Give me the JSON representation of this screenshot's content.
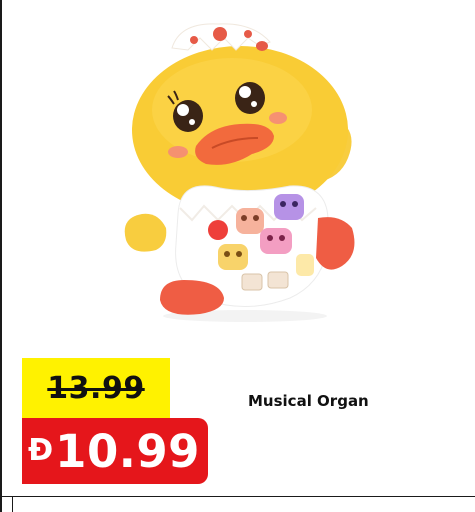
{
  "product": {
    "name": "Musical Organ",
    "image_alt_icon": "duck-musical-toy-image"
  },
  "pricing": {
    "old_price": "13.99",
    "new_price": "10.99",
    "currency_symbol": "Đ"
  },
  "colors": {
    "old_price_background": "#fff200",
    "new_price_background": "#e5161b",
    "text_dark": "#111111",
    "text_light": "#ffffff"
  }
}
